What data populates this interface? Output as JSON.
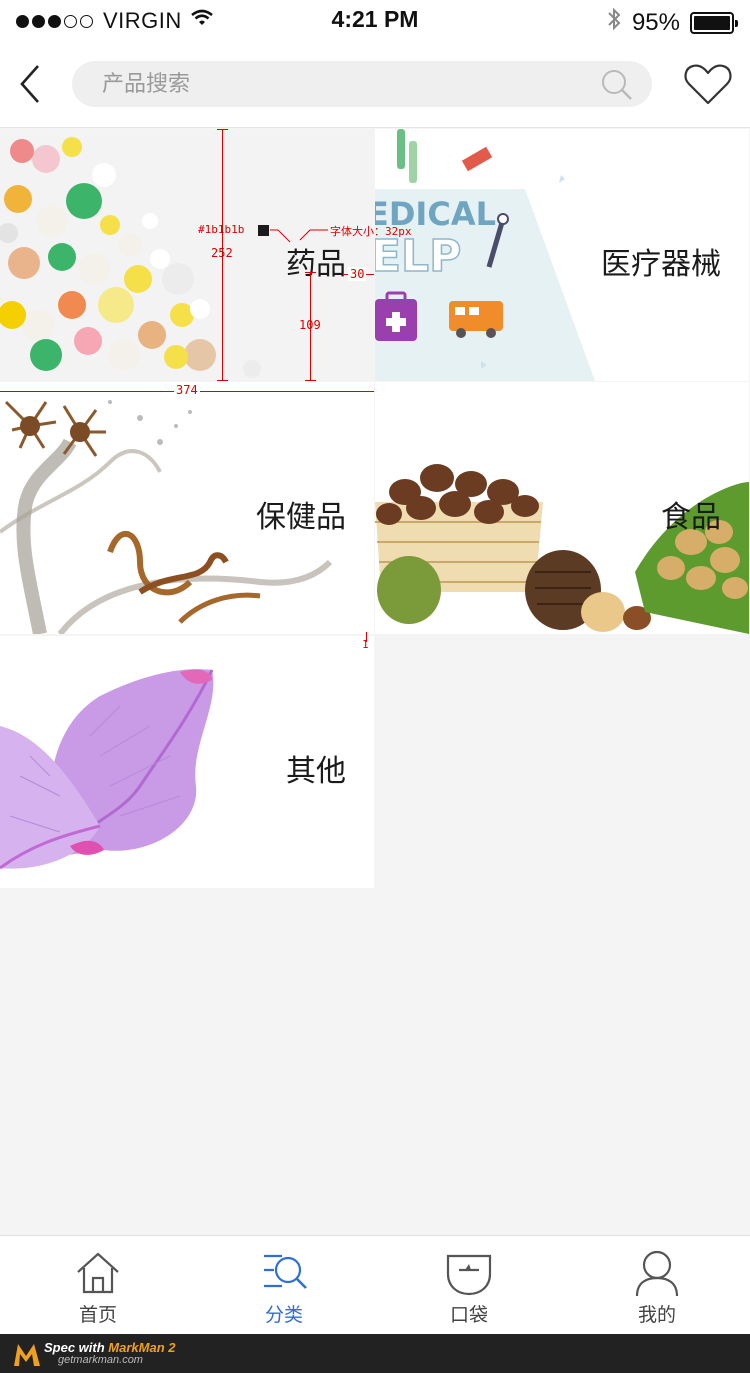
{
  "status_bar": {
    "carrier": "VIRGIN",
    "time": "4:21 PM",
    "battery": "95%",
    "battery_level": 0.95,
    "signal_dots_filled": 3,
    "signal_dots_total": 5
  },
  "header": {
    "search_placeholder": "产品搜索",
    "back_icon": "chevron-left-icon",
    "search_icon": "search-icon",
    "favorite_icon": "heart-icon"
  },
  "categories": [
    {
      "label": "药品",
      "image": "pills"
    },
    {
      "label": "医疗器械",
      "image": "medical-help"
    },
    {
      "label": "保健品",
      "image": "cordyceps"
    },
    {
      "label": "食品",
      "image": "nuts"
    },
    {
      "label": "其他",
      "image": "petals"
    }
  ],
  "artwork": {
    "medical_text_1": "EDICAL",
    "medical_text_2": "ELP"
  },
  "annotations": {
    "color_label": "#1b1b1b",
    "font_label": "字体大小：32px",
    "height": "252",
    "right_margin": "30",
    "bottom": "109",
    "width": "374",
    "gap": "1"
  },
  "tabbar": {
    "items": [
      {
        "label": "首页",
        "icon": "home-icon",
        "active": false
      },
      {
        "label": "分类",
        "icon": "category-search-icon",
        "active": true
      },
      {
        "label": "口袋",
        "icon": "pocket-icon",
        "active": false
      },
      {
        "label": "我的",
        "icon": "user-icon",
        "active": false
      }
    ]
  },
  "watermark": {
    "prefix": "Spec with ",
    "brand": "MarkMan 2",
    "url": "getmarkman.com"
  },
  "colors": {
    "accent": "#2f6fd3",
    "label": "#1b1b1b",
    "annotation": "#dd0000",
    "background": "#f4f4f4"
  }
}
